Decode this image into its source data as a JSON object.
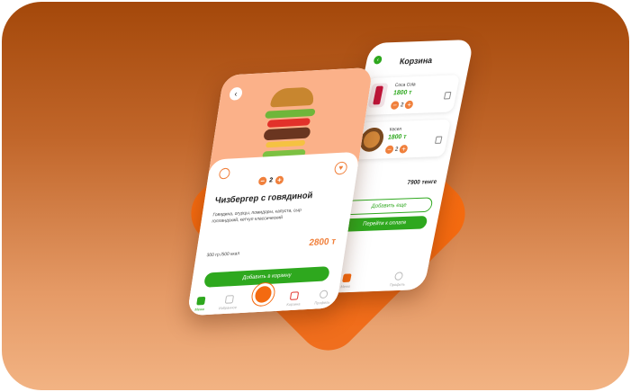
{
  "cart": {
    "title": "Корзина",
    "items": [
      {
        "name": "Coca Cola",
        "price": "1800 т",
        "qty": "2"
      },
      {
        "name": "Кесел",
        "price": "1800 т",
        "qty": "2"
      }
    ],
    "total": "7900 тенге",
    "add_button": "Добавить еще",
    "pay_button": "Перейти к оплате",
    "nav": [
      "Меню",
      "Профиль"
    ]
  },
  "product": {
    "qty": "2",
    "title": "Чизбергер с говядиной",
    "description": "Говядина, огурцы, помидоры, капуста, сыр голландский, кетчуп классический",
    "weight": "300 гр./500 ккал",
    "price": "2800 т",
    "add_button": "Добавить в корзину",
    "nav": [
      "Меню",
      "Избранное",
      "Корзина",
      "Профиль"
    ]
  },
  "colors": {
    "accent": "#f46a10",
    "green": "#2ea81e",
    "price_orange": "#f0803c"
  }
}
